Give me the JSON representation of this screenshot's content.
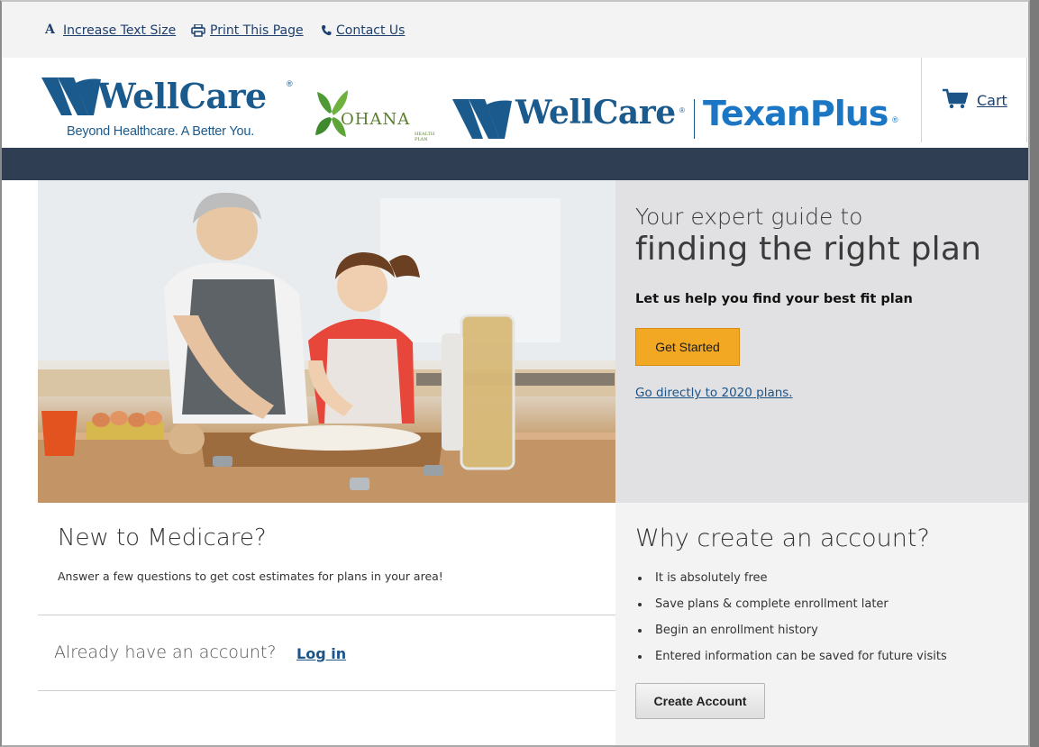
{
  "utility_bar": {
    "increase_text": "Increase Text Size",
    "print_page": "Print This Page",
    "contact_us": "Contact Us"
  },
  "header": {
    "wellcare_name": "WellCare",
    "wellcare_tagline": "Beyond Healthcare. A Better You.",
    "ohana_name": "OHANA",
    "ohana_sub": "HEALTH PLAN",
    "texanplus_wellcare": "WellCare",
    "texanplus_name": "TexanPlus",
    "cart_label": "Cart"
  },
  "hero": {
    "guide_line": "Your expert guide to",
    "find_line": "finding the right plan",
    "help_line": "Let us help you find your best fit plan",
    "get_started": "Get Started",
    "go_direct": "Go directly to 2020 plans."
  },
  "new_to_medicare": {
    "title": "New to Medicare?",
    "description": "Answer a few questions to get cost estimates for plans in your area!"
  },
  "account": {
    "already_text": "Already have an account?",
    "login_label": "Log in"
  },
  "why_account": {
    "title": "Why create an account?",
    "items": [
      "It is absolutely free",
      "Save plans & complete enrollment later",
      "Begin an enrollment history",
      "Entered information can be saved for future visits"
    ],
    "create_button": "Create Account"
  },
  "colors": {
    "brand_blue": "#1b5a8c",
    "texan_blue": "#1b76c3",
    "nav_bar": "#2f3e52",
    "accent_orange": "#f3a823",
    "link_blue": "#1c5488"
  }
}
